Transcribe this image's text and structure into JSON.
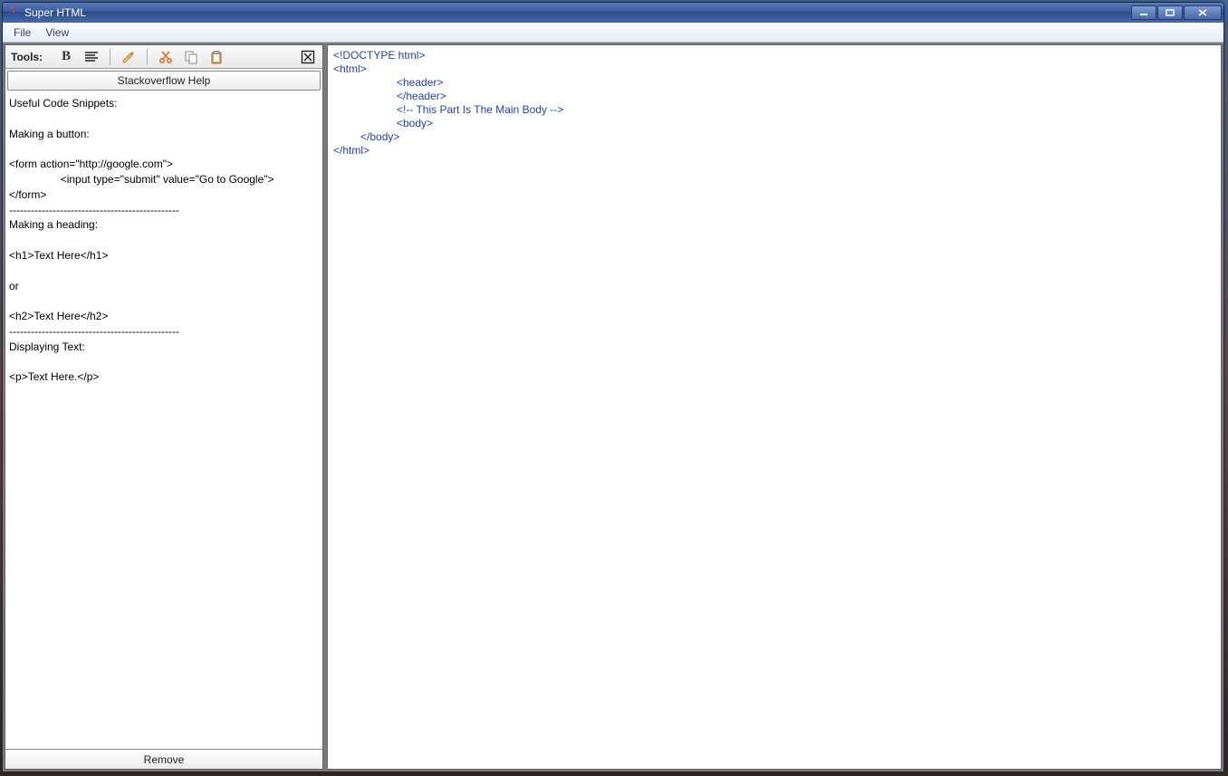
{
  "window": {
    "title": "Super HTML"
  },
  "menubar": {
    "file": "File",
    "view": "View"
  },
  "toolbar": {
    "label": "Tools:"
  },
  "sidebar": {
    "help_button": "Stackoverflow Help",
    "remove_button": "Remove",
    "snippets_text": "Useful Code Snippets:\n\nMaking a button:\n\n<form action=\"http://google.com\">\n                 <input type=\"submit\" value=\"Go to Google\">\n</form>\n-----------------------------------------------\nMaking a heading:\n\n<h1>Text Here</h1>\n\nor\n\n<h2>Text Here</h2>\n-----------------------------------------------\nDisplaying Text:\n\n<p>Text Here.</p>"
  },
  "editor": {
    "lines": {
      "l1": "<!DOCTYPE html>",
      "l2": "<html>",
      "l3": "<header>",
      "l4": "</header>",
      "l5": "",
      "l6": "<!-- This Part Is The Main Body -->",
      "l7": "<body>",
      "l8": "</body>",
      "l9": "</html>"
    }
  }
}
